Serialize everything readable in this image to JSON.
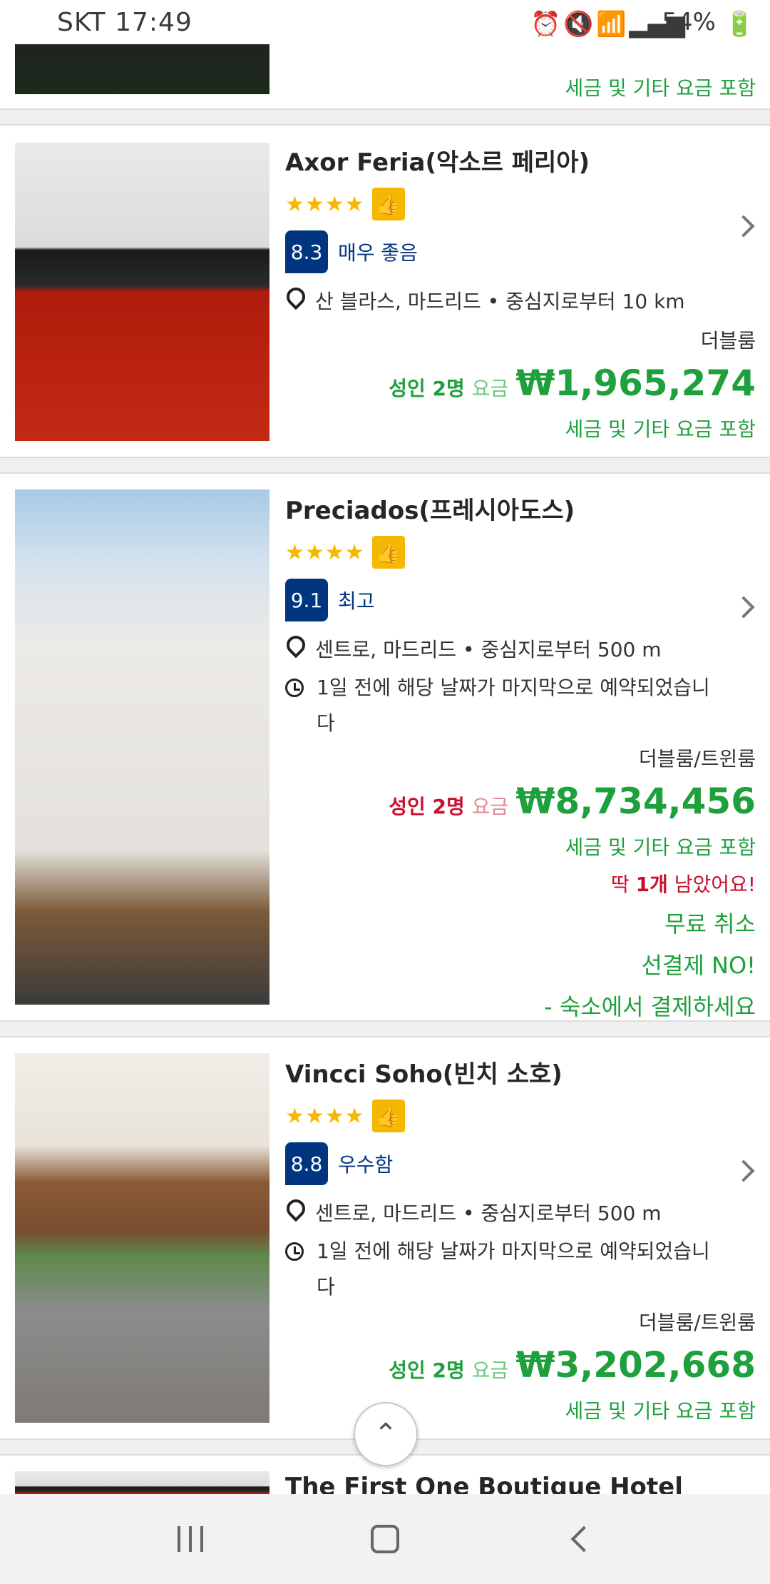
{
  "status_bar": {
    "carrier_time": "SKT 17:49",
    "battery": "54%",
    "icons": [
      "alarm-icon",
      "mute-icon",
      "wifi-icon",
      "signal-icon",
      "battery-icon"
    ]
  },
  "top_card": {
    "tax_note": "세금 및 기타 요금 포함"
  },
  "hotels": [
    {
      "name": "Axor Feria(악소르 페리아)",
      "stars": "★★★★",
      "rating_score": "8.3",
      "rating_label": "매우 좋음",
      "location": "산 블라스, 마드리드 • 중심지로부터 10 km",
      "room_type": "더블룸",
      "guests": "성인 2명",
      "per_label": "요금",
      "price": "₩1,965,274",
      "tax_note": "세금 및 기타 요금 포함"
    },
    {
      "name": "Preciados(프레시아도스)",
      "stars": "★★★★",
      "rating_score": "9.1",
      "rating_label": "최고",
      "location": "센트로, 마드리드 • 중심지로부터 500 m",
      "recent_booking": "1일 전에 해당 날짜가 마지막으로 예약되었습니다",
      "room_type": "더블룸/트윈룸",
      "guests": "성인 2명",
      "per_label": "요금",
      "price": "₩8,734,456",
      "tax_note": "세금 및 기타 요금 포함",
      "scarcity_prefix": "딱 ",
      "scarcity_bold": "1개",
      "scarcity_suffix": " 남았어요!",
      "free_cancel": "무료 취소",
      "no_prepay": "선결제 NO!",
      "pay_at_property": "- 숙소에서 결제하세요"
    },
    {
      "name": "Vincci Soho(빈치 소호)",
      "stars": "★★★★",
      "rating_score": "8.8",
      "rating_label": "우수함",
      "location": "센트로, 마드리드 • 중심지로부터 500 m",
      "recent_booking": "1일 전에 해당 날짜가 마지막으로 예약되었습니다",
      "room_type": "더블룸/트윈룸",
      "guests": "성인 2명",
      "per_label": "요금",
      "price": "₩3,202,668",
      "tax_note": "세금 및 기타 요금 포함"
    },
    {
      "name": "The First One Boutique Hotel"
    }
  ],
  "scroll_top_symbol": "⌃",
  "nav": [
    "recents-icon",
    "home-icon",
    "back-icon"
  ]
}
